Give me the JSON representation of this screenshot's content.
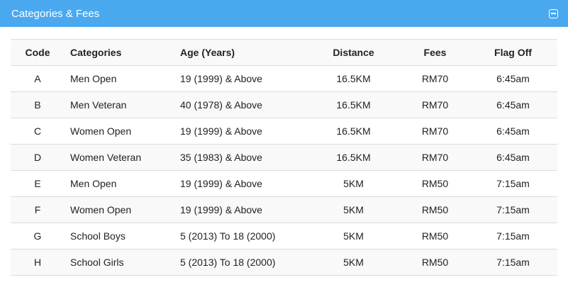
{
  "panel": {
    "title": "Categories & Fees",
    "header_color": "#4aa8ef",
    "collapse_icon": "minus-square-icon"
  },
  "table": {
    "headers": {
      "code": "Code",
      "categories": "Categories",
      "age": "Age (Years)",
      "distance": "Distance",
      "fees": "Fees",
      "flag_off": "Flag Off"
    },
    "rows": [
      {
        "code": "A",
        "category": "Men Open",
        "age": "19 (1999) & Above",
        "distance": "16.5KM",
        "fees": "RM70",
        "flag_off": "6:45am"
      },
      {
        "code": "B",
        "category": "Men Veteran",
        "age": "40 (1978) & Above",
        "distance": "16.5KM",
        "fees": "RM70",
        "flag_off": "6:45am"
      },
      {
        "code": "C",
        "category": "Women Open",
        "age": "19 (1999) & Above",
        "distance": "16.5KM",
        "fees": "RM70",
        "flag_off": "6:45am"
      },
      {
        "code": "D",
        "category": "Women Veteran",
        "age": "35 (1983) & Above",
        "distance": "16.5KM",
        "fees": "RM70",
        "flag_off": "6:45am"
      },
      {
        "code": "E",
        "category": "Men Open",
        "age": "19 (1999) & Above",
        "distance": "5KM",
        "fees": "RM50",
        "flag_off": "7:15am"
      },
      {
        "code": "F",
        "category": "Women Open",
        "age": "19 (1999) & Above",
        "distance": "5KM",
        "fees": "RM50",
        "flag_off": "7:15am"
      },
      {
        "code": "G",
        "category": "School Boys",
        "age": "5 (2013) To 18 (2000)",
        "distance": "5KM",
        "fees": "RM50",
        "flag_off": "7:15am"
      },
      {
        "code": "H",
        "category": "School Girls",
        "age": "5 (2013) To 18 (2000)",
        "distance": "5KM",
        "fees": "RM50",
        "flag_off": "7:15am"
      }
    ]
  }
}
